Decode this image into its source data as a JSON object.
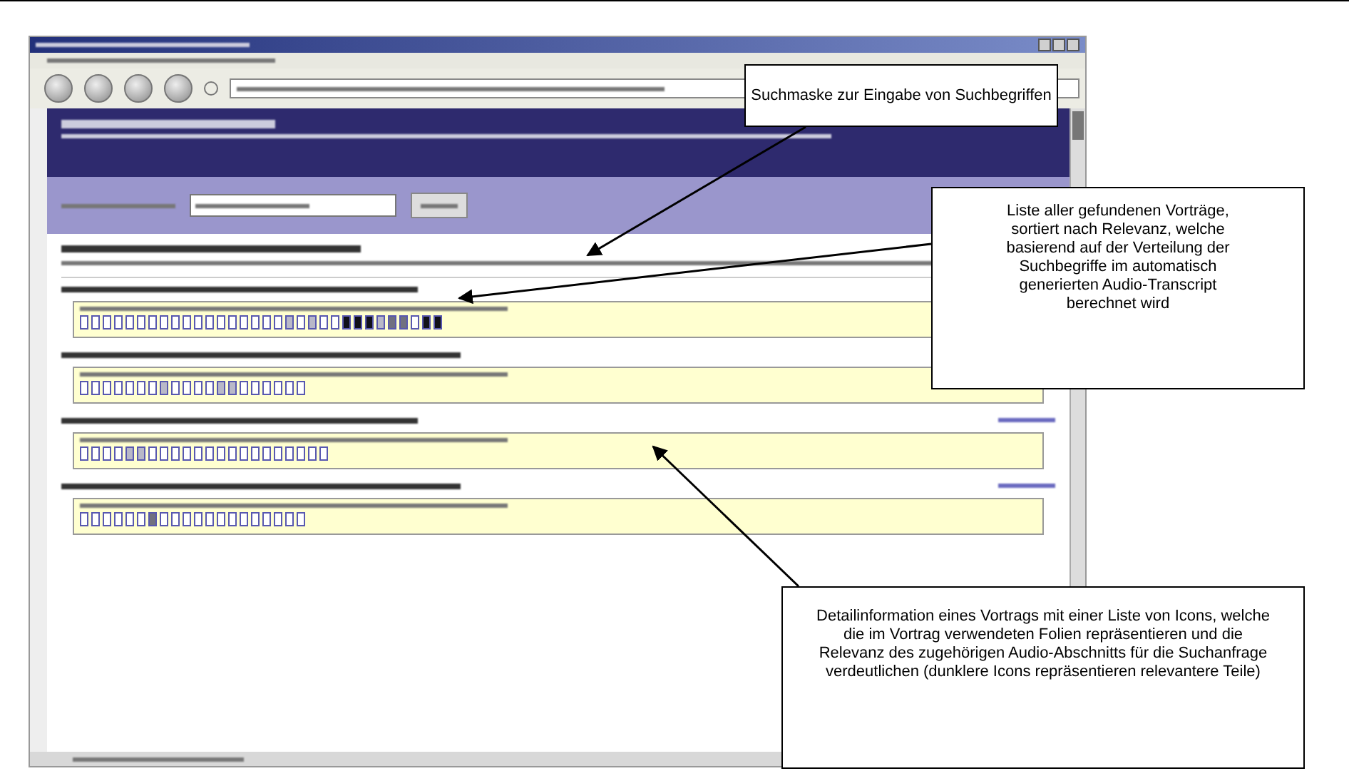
{
  "callouts": [
    {
      "text": "Suchmaske zur Eingabe von Suchbegriffen"
    },
    {
      "text": "Liste aller gefundenen Vorträge, sortiert nach Relevanz, welche basierend auf der Verteilung der Suchbegriffe im automatisch generierten Audio-Transcript berechnet wird"
    },
    {
      "text": "Detailinformation eines Vortrags mit einer Liste von Icons, welche die im Vortrag verwendeten Folien repräsentieren und die Relevanz des zugehörigen Audio-Abschnitts für die Suchanfrage verdeutlichen (dunklere Icons repräsentieren relevantere Teile)"
    }
  ],
  "results": [
    {
      "slides": [
        {
          "kind": "plain"
        },
        {
          "kind": "plain"
        },
        {
          "kind": "plain"
        },
        {
          "kind": "plain"
        },
        {
          "kind": "plain"
        },
        {
          "kind": "plain"
        },
        {
          "kind": "plain"
        },
        {
          "kind": "plain"
        },
        {
          "kind": "plain"
        },
        {
          "kind": "plain"
        },
        {
          "kind": "plain"
        },
        {
          "kind": "plain"
        },
        {
          "kind": "plain"
        },
        {
          "kind": "plain"
        },
        {
          "kind": "plain"
        },
        {
          "kind": "plain"
        },
        {
          "kind": "plain"
        },
        {
          "kind": "plain"
        },
        {
          "kind": "light"
        },
        {
          "kind": "plain"
        },
        {
          "kind": "light"
        },
        {
          "kind": "plain"
        },
        {
          "kind": "plain"
        },
        {
          "kind": "dark"
        },
        {
          "kind": "dark"
        },
        {
          "kind": "dark"
        },
        {
          "kind": "light"
        },
        {
          "kind": "medium"
        },
        {
          "kind": "medium"
        },
        {
          "kind": "plain"
        },
        {
          "kind": "dark"
        },
        {
          "kind": "dark"
        }
      ]
    },
    {
      "slides": [
        {
          "kind": "plain"
        },
        {
          "kind": "plain"
        },
        {
          "kind": "plain"
        },
        {
          "kind": "plain"
        },
        {
          "kind": "plain"
        },
        {
          "kind": "plain"
        },
        {
          "kind": "plain"
        },
        {
          "kind": "light"
        },
        {
          "kind": "plain"
        },
        {
          "kind": "plain"
        },
        {
          "kind": "plain"
        },
        {
          "kind": "plain"
        },
        {
          "kind": "light"
        },
        {
          "kind": "light"
        },
        {
          "kind": "plain"
        },
        {
          "kind": "plain"
        },
        {
          "kind": "plain"
        },
        {
          "kind": "plain"
        },
        {
          "kind": "plain"
        },
        {
          "kind": "plain"
        }
      ]
    },
    {
      "slides": [
        {
          "kind": "plain"
        },
        {
          "kind": "plain"
        },
        {
          "kind": "plain"
        },
        {
          "kind": "plain"
        },
        {
          "kind": "light"
        },
        {
          "kind": "light"
        },
        {
          "kind": "plain"
        },
        {
          "kind": "plain"
        },
        {
          "kind": "plain"
        },
        {
          "kind": "plain"
        },
        {
          "kind": "plain"
        },
        {
          "kind": "plain"
        },
        {
          "kind": "plain"
        },
        {
          "kind": "plain"
        },
        {
          "kind": "plain"
        },
        {
          "kind": "plain"
        },
        {
          "kind": "plain"
        },
        {
          "kind": "plain"
        },
        {
          "kind": "plain"
        },
        {
          "kind": "plain"
        },
        {
          "kind": "plain"
        },
        {
          "kind": "plain"
        }
      ]
    },
    {
      "slides": [
        {
          "kind": "plain"
        },
        {
          "kind": "plain"
        },
        {
          "kind": "plain"
        },
        {
          "kind": "plain"
        },
        {
          "kind": "plain"
        },
        {
          "kind": "plain"
        },
        {
          "kind": "medium"
        },
        {
          "kind": "plain"
        },
        {
          "kind": "plain"
        },
        {
          "kind": "plain"
        },
        {
          "kind": "plain"
        },
        {
          "kind": "plain"
        },
        {
          "kind": "plain"
        },
        {
          "kind": "plain"
        },
        {
          "kind": "plain"
        },
        {
          "kind": "plain"
        },
        {
          "kind": "plain"
        },
        {
          "kind": "plain"
        },
        {
          "kind": "plain"
        },
        {
          "kind": "plain"
        }
      ]
    }
  ]
}
